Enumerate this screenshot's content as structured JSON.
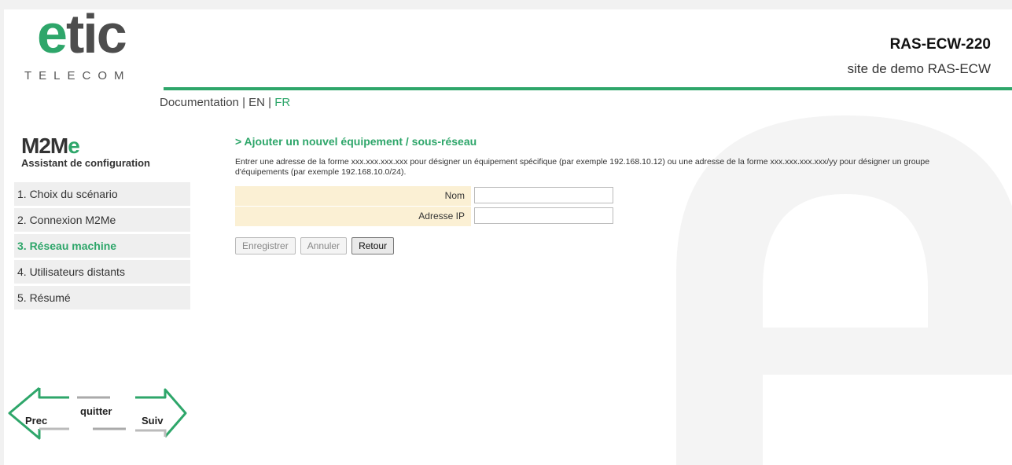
{
  "header": {
    "logo_main": "etic",
    "logo_sub": "TELECOM",
    "device_name": "RAS-ECW-220",
    "site_name": "site de demo RAS-ECW"
  },
  "docnav": {
    "documentation": "Documentation",
    "sep1": " | ",
    "en": "EN",
    "sep2": " | ",
    "fr": "FR"
  },
  "wizard": {
    "title": "M2Me",
    "subtitle": "Assistant de configuration",
    "steps": [
      {
        "label": "1. Choix du scénario"
      },
      {
        "label": "2. Connexion M2Me"
      },
      {
        "label": "3. Réseau machine"
      },
      {
        "label": "4. Utilisateurs distants"
      },
      {
        "label": "5. Résumé"
      }
    ],
    "active_step": 2,
    "prev": "Prec",
    "quit": "quitter",
    "next": "Suiv"
  },
  "main": {
    "heading": "> Ajouter un nouvel équipement / sous-réseau",
    "description": "Entrer une adresse de la forme xxx.xxx.xxx.xxx pour désigner un équipement spécifique (par exemple 192.168.10.12) ou une adresse de la forme xxx.xxx.xxx.xxx/yy pour désigner un groupe d'équipements (par exemple 192.168.10.0/24).",
    "fields": [
      {
        "label": "Nom",
        "value": ""
      },
      {
        "label": "Adresse IP",
        "value": ""
      }
    ],
    "buttons": {
      "save": "Enregistrer",
      "cancel": "Annuler",
      "back": "Retour"
    }
  },
  "colors": {
    "accent": "#2ea66a",
    "label_bg": "#fbf0d4",
    "step_bg": "#efefef"
  }
}
